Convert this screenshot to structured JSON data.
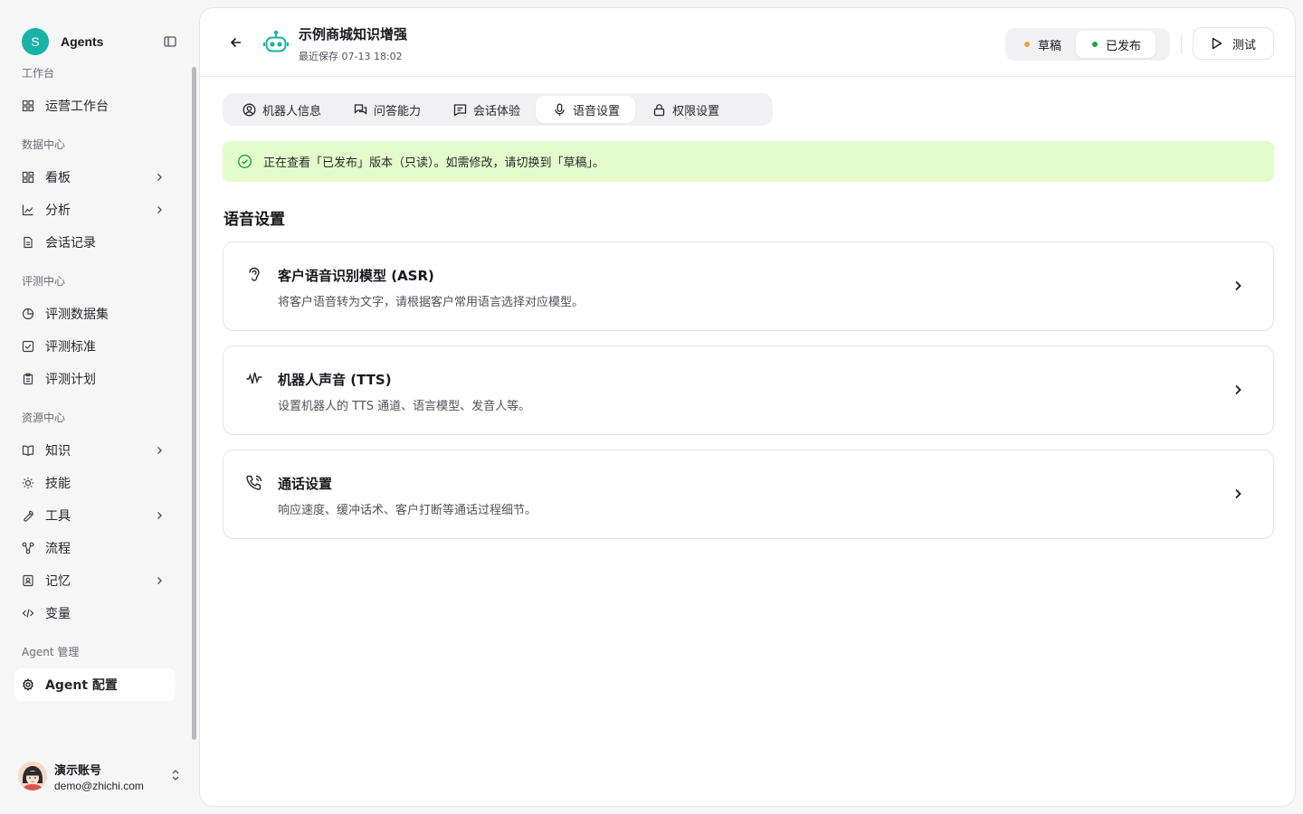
{
  "sidebar": {
    "brand": {
      "logo_letter": "S",
      "name": "Agents"
    },
    "sections": [
      {
        "title": "工作台",
        "items": [
          {
            "label": "运营工作台",
            "icon": "dashboard-icon",
            "chevron": false
          }
        ]
      },
      {
        "title": "数据中心",
        "items": [
          {
            "label": "看板",
            "icon": "board-icon",
            "chevron": true
          },
          {
            "label": "分析",
            "icon": "chart-icon",
            "chevron": true
          },
          {
            "label": "会话记录",
            "icon": "document-icon",
            "chevron": false
          }
        ]
      },
      {
        "title": "评测中心",
        "items": [
          {
            "label": "评测数据集",
            "icon": "pie-icon",
            "chevron": false
          },
          {
            "label": "评测标准",
            "icon": "checkbox-icon",
            "chevron": false
          },
          {
            "label": "评测计划",
            "icon": "clipboard-icon",
            "chevron": false
          }
        ]
      },
      {
        "title": "资源中心",
        "items": [
          {
            "label": "知识",
            "icon": "book-icon",
            "chevron": true
          },
          {
            "label": "技能",
            "icon": "sun-icon",
            "chevron": false
          },
          {
            "label": "工具",
            "icon": "wrench-icon",
            "chevron": true
          },
          {
            "label": "流程",
            "icon": "flow-icon",
            "chevron": false
          },
          {
            "label": "记忆",
            "icon": "memory-icon",
            "chevron": true
          },
          {
            "label": "变量",
            "icon": "code-icon",
            "chevron": false
          }
        ]
      },
      {
        "title": "Agent 管理",
        "items": [
          {
            "label": "Agent 配置",
            "icon": "gear-icon",
            "chevron": false,
            "active": true
          }
        ]
      }
    ],
    "account": {
      "name": "演示账号",
      "email": "demo@zhichi.com"
    }
  },
  "header": {
    "title": "示例商城知识增强",
    "subtitle": "最近保存 07-13 18:02",
    "toggle": [
      {
        "label": "草稿",
        "dot_color": "#f59e3b",
        "active": false
      },
      {
        "label": "已发布",
        "dot_color": "#22a33a",
        "active": true
      }
    ],
    "test_label": "测试"
  },
  "tabs": [
    {
      "label": "机器人信息",
      "icon": "user-circle-icon",
      "active": false
    },
    {
      "label": "问答能力",
      "icon": "chat-bubbles-icon",
      "active": false
    },
    {
      "label": "会话体验",
      "icon": "message-icon",
      "active": false
    },
    {
      "label": "语音设置",
      "icon": "microphone-icon",
      "active": true
    },
    {
      "label": "权限设置",
      "icon": "lock-icon",
      "active": false
    }
  ],
  "banner": {
    "text": "正在查看「已发布」版本（只读）。如需修改，请切换到「草稿」。"
  },
  "section_title": "语音设置",
  "cards": [
    {
      "title": "客户语音识别模型 (ASR)",
      "desc": "将客户语音转为文字，请根据客户常用语言选择对应模型。",
      "icon": "ear-icon"
    },
    {
      "title": "机器人声音 (TTS)",
      "desc": "设置机器人的 TTS 通道、语言模型、发音人等。",
      "icon": "audio-wave-icon"
    },
    {
      "title": "通话设置",
      "desc": "响应速度、缓冲话术、客户打断等通话过程细节。",
      "icon": "phone-icon"
    }
  ],
  "colors": {
    "accent": "#17b3a6",
    "banner_bg": "#e4fccb",
    "banner_icon": "#16a34a"
  }
}
